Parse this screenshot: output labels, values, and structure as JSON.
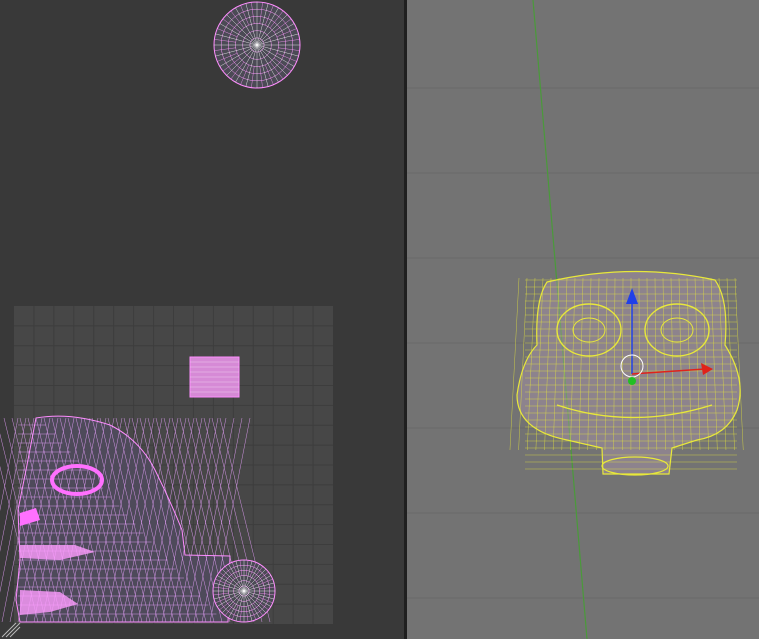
{
  "uv_editor": {
    "background": "#393939",
    "grid_background": "#474747",
    "grid_line_color": "#3a3a3a",
    "uv_wire_color": "#ff8cff",
    "uv_vertex_color": "#ffffff",
    "icons": {
      "corner": "area-split-corner-icon"
    }
  },
  "viewport": {
    "background": "#737373",
    "grid_color": "#666666",
    "axis_y_color": "#4a9a3a",
    "mesh_wire_color": "#e8e83a",
    "gizmo": {
      "x_color": "#e0231a",
      "z_color": "#2040e8",
      "y_color": "#22c022",
      "icons": [
        "translate-x-arrow-icon",
        "translate-z-arrow-icon",
        "pivot-center-icon"
      ]
    }
  }
}
